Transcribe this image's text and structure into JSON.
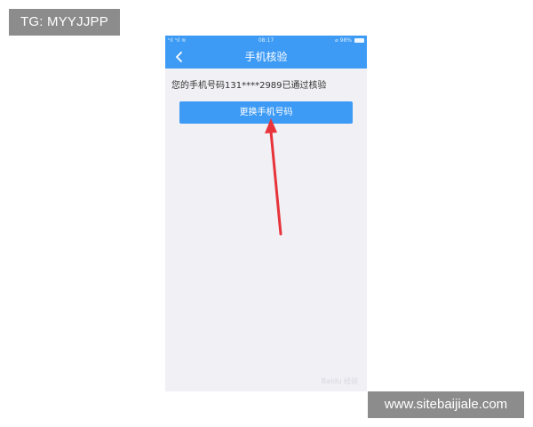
{
  "overlay": {
    "tg_label": "TG: MYYJJPP",
    "site_label": "www.sitebaijiale.com"
  },
  "status_bar": {
    "signal": "ⁿıl ⁿıl ≋",
    "time": "08:17",
    "battery_text": "⌀ 98%"
  },
  "nav": {
    "back_icon": "chevron-left-icon",
    "title": "手机核验"
  },
  "content": {
    "verified_text": "您的手机号码131****2989已通过核验",
    "change_button_label": "更换手机号码"
  },
  "annotation": {
    "arrow_color": "#e8333a"
  },
  "watermark": {
    "text": "Baidu 经验"
  },
  "colors": {
    "primary": "#3e9bf5",
    "background": "#f0f0f5"
  }
}
